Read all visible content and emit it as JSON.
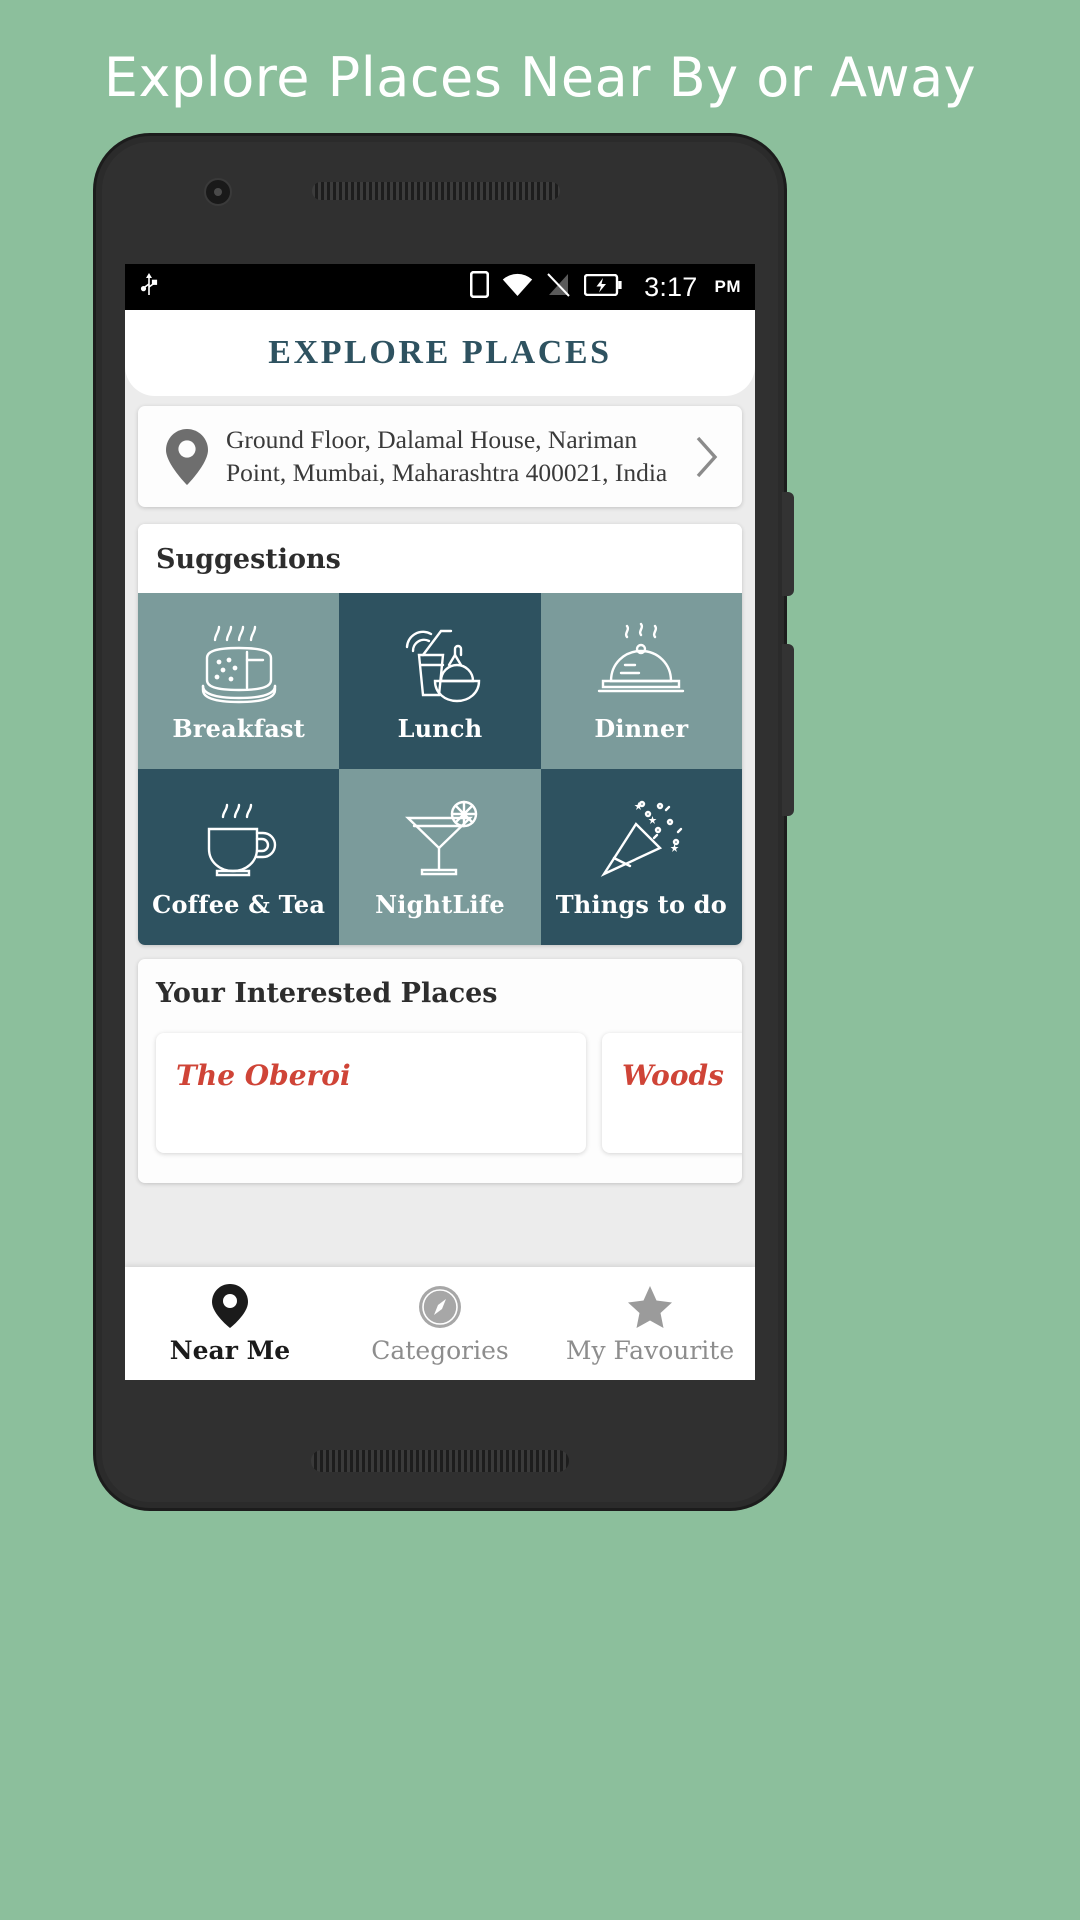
{
  "promo": {
    "title": "Explore Places Near By or Away"
  },
  "colors": {
    "page_background": "#8cbf9c",
    "tile_light": "#7b9b9b",
    "tile_dark": "#2e5260",
    "appbar_title": "#2e5260",
    "place_name": "#cf4437",
    "nav_active": "#1b1b1b",
    "nav_inactive": "#8d8d8d"
  },
  "statusbar": {
    "usb_icon": "usb-icon",
    "sim_icon": "sim-card-icon",
    "wifi_icon": "wifi-icon",
    "signal_icon": "signal-off-icon",
    "battery_icon": "battery-charging-icon",
    "time": "3:17",
    "ampm": "PM"
  },
  "appbar": {
    "title": "EXPLORE PLACES"
  },
  "address": {
    "pin_icon": "location-pin-icon",
    "text": "Ground Floor, Dalamal House, Nariman Point, Mumbai, Maharashtra 400021, India",
    "chevron_icon": "chevron-right-icon"
  },
  "suggestions": {
    "title": "Suggestions",
    "tiles": [
      {
        "label": "Breakfast",
        "icon": "toast-bread-icon",
        "tone": "light"
      },
      {
        "label": "Lunch",
        "icon": "drink-bowl-icon",
        "tone": "dark"
      },
      {
        "label": "Dinner",
        "icon": "cloche-dish-icon",
        "tone": "light"
      },
      {
        "label": "Coffee & Tea",
        "icon": "coffee-cup-icon",
        "tone": "dark"
      },
      {
        "label": "NightLife",
        "icon": "cocktail-glass-icon",
        "tone": "light"
      },
      {
        "label": "Things to do",
        "icon": "party-popper-icon",
        "tone": "dark"
      }
    ]
  },
  "interested": {
    "title": "Your Interested Places",
    "places": [
      {
        "name": "The Oberoi"
      },
      {
        "name": "Woods"
      }
    ]
  },
  "bottomnav": {
    "items": [
      {
        "label": "Near Me",
        "icon": "location-pin-icon",
        "state": "active"
      },
      {
        "label": "Categories",
        "icon": "compass-icon",
        "state": "inactive"
      },
      {
        "label": "My Favourite",
        "icon": "star-icon",
        "state": "inactive"
      }
    ]
  }
}
